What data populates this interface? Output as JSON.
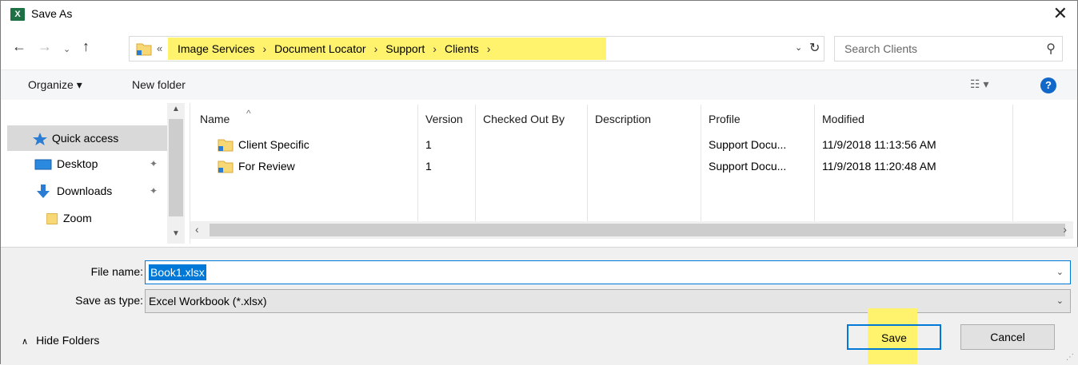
{
  "window": {
    "title": "Save As",
    "app_icon_text": "X",
    "close_glyph": "✕"
  },
  "nav": {
    "back": "←",
    "forward": "→",
    "recent": "⌄",
    "up": "↑"
  },
  "address": {
    "chevron": "«",
    "crumbs": [
      "Image Services",
      "Document Locator",
      "Support",
      "Clients"
    ],
    "separator": "›",
    "dropdown": "⌄",
    "refresh": "↻"
  },
  "search": {
    "placeholder": "Search Clients",
    "icon": "⚲"
  },
  "toolbar": {
    "organize": "Organize ▾",
    "new_folder": "New folder",
    "view": "☷ ▾",
    "help": "?"
  },
  "sidebar": {
    "items": [
      {
        "label": "Quick access",
        "icon": "star-icon",
        "pinned": false
      },
      {
        "label": "Desktop",
        "icon": "desktop-icon",
        "pinned": true
      },
      {
        "label": "Downloads",
        "icon": "download-icon",
        "pinned": true
      },
      {
        "label": "Zoom",
        "icon": "folder-icon",
        "pinned": false
      }
    ],
    "pin_glyph": "📌"
  },
  "files": {
    "columns": [
      "Name",
      "Version",
      "Checked Out By",
      "Description",
      "Profile",
      "Modified"
    ],
    "sort_caret": "^",
    "rows": [
      {
        "name": "Client Specific",
        "version": "1",
        "checked_out_by": "",
        "description": "",
        "profile": "Support Docu...",
        "modified": "11/9/2018 11:13:56 AM"
      },
      {
        "name": "For Review",
        "version": "1",
        "checked_out_by": "",
        "description": "",
        "profile": "Support Docu...",
        "modified": "11/9/2018 11:20:48 AM"
      }
    ]
  },
  "form": {
    "file_name_label": "File name:",
    "file_name_value": "Book1.xlsx",
    "type_label": "Save as type:",
    "type_value": "Excel Workbook (*.xlsx)",
    "dropdown": "⌄"
  },
  "footer": {
    "hide_folders": "Hide Folders",
    "hide_caret": "∧",
    "save": "Save",
    "cancel": "Cancel"
  },
  "colors": {
    "highlight": "#fff36d",
    "accent": "#0078d7",
    "excel": "#1e7145",
    "folder": "#f8d775"
  }
}
